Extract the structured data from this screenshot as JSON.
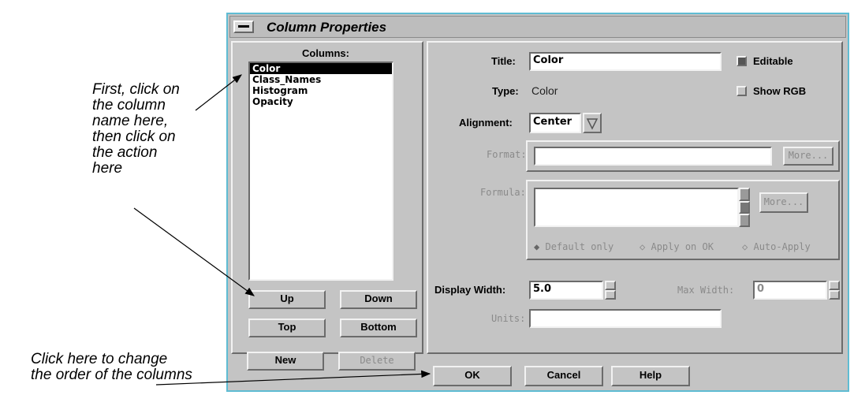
{
  "annotations": {
    "step_note": "First, click on\nthe column\nname here,\nthen click on\nthe action\nhere",
    "order_note": "Click here to change\nthe order of the columns"
  },
  "window": {
    "title": "Column Properties"
  },
  "columns_panel": {
    "header": "Columns:",
    "items": [
      "Color",
      "Class_Names",
      "Histogram",
      "Opacity"
    ],
    "selected": "Color",
    "buttons": {
      "up": "Up",
      "down": "Down",
      "top": "Top",
      "bottom": "Bottom",
      "new": "New",
      "delete": "Delete"
    }
  },
  "properties": {
    "title_label": "Title:",
    "title_value": "Color",
    "editable_label": "Editable",
    "editable_checked": true,
    "type_label": "Type:",
    "type_value": "Color",
    "show_rgb_label": "Show RGB",
    "show_rgb_checked": false,
    "alignment_label": "Alignment:",
    "alignment_value": "Center",
    "format_label": "Format:",
    "format_value": "",
    "format_more": "More...",
    "formula_label": "Formula:",
    "formula_value": "",
    "formula_more": "More...",
    "apply_options": [
      "Default only",
      "Apply on OK",
      "Auto-Apply"
    ],
    "apply_selected": "Default only",
    "display_width_label": "Display Width:",
    "display_width_value": "5.0",
    "max_width_label": "Max Width:",
    "max_width_value": "0",
    "units_label": "Units:",
    "units_value": ""
  },
  "footer": {
    "ok": "OK",
    "cancel": "Cancel",
    "help": "Help"
  },
  "colors": {
    "dialog_bg": "#c4c4c4",
    "frame": "#5fbcd3",
    "selection": "#000000"
  }
}
